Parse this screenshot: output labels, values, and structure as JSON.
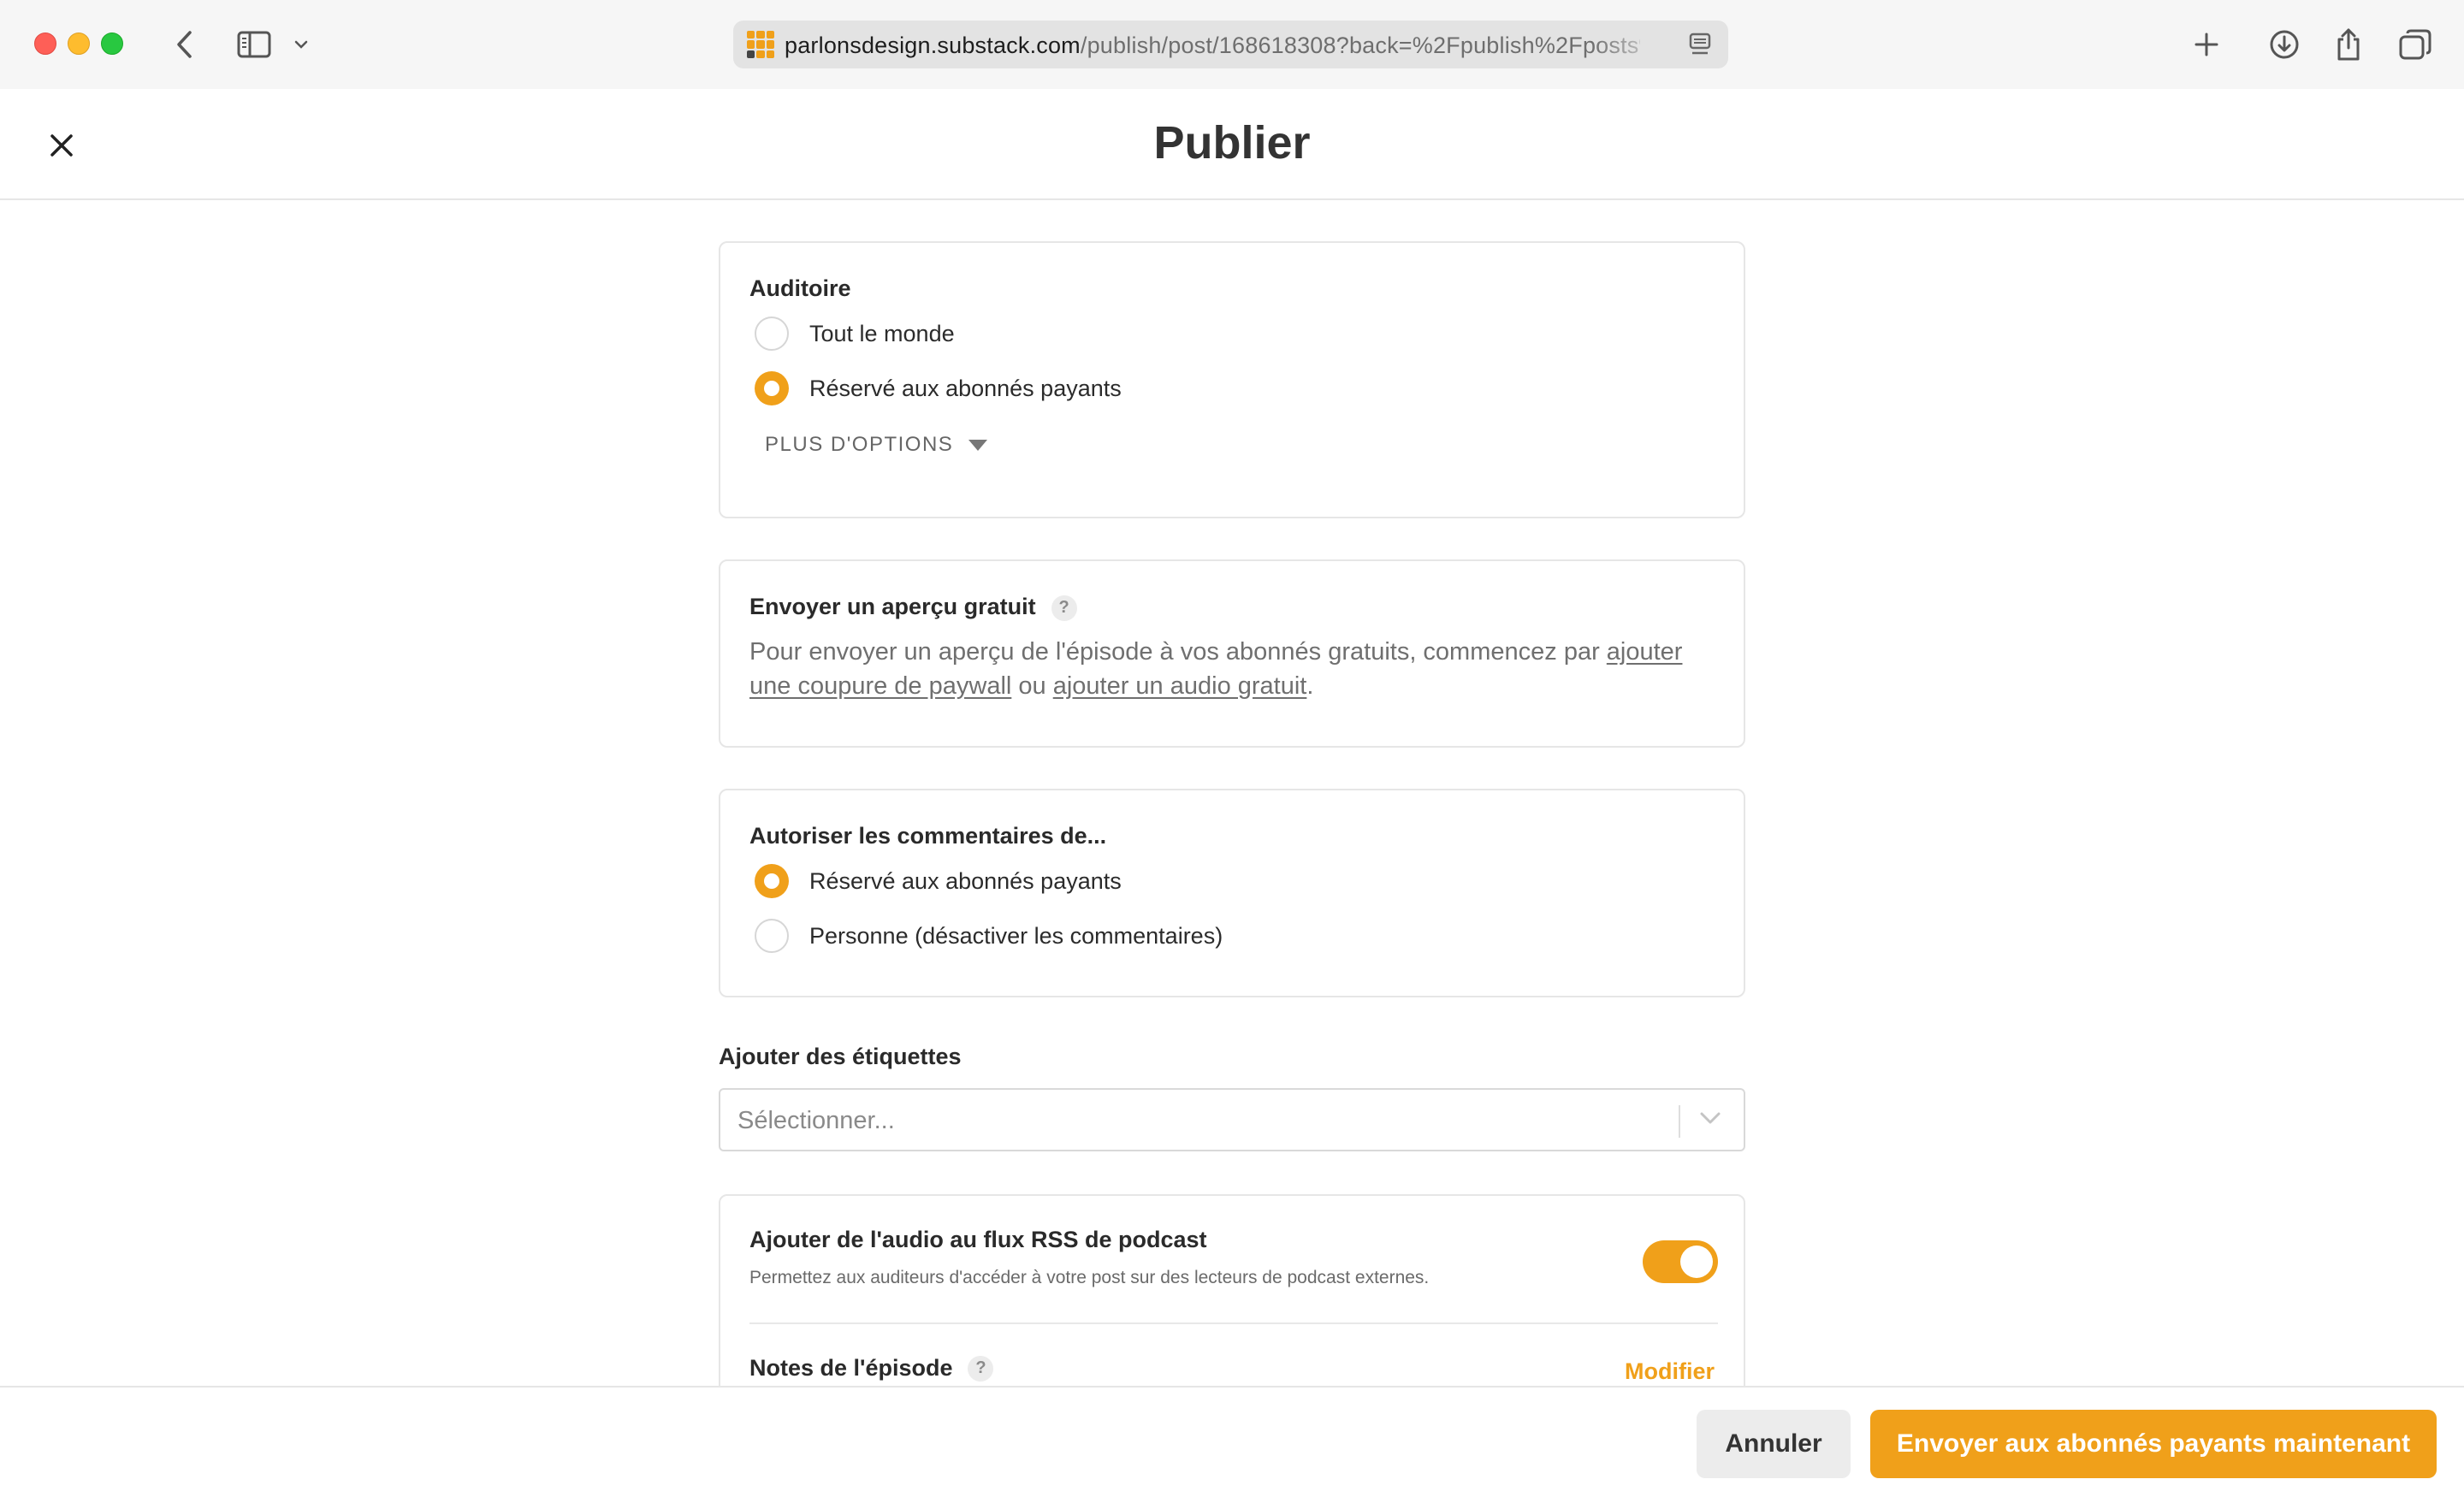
{
  "browser": {
    "url_host": "parlonsdesign.substack.com",
    "url_path": "/publish/post/168618308?back=%2Fpublish%2Fposts%"
  },
  "header": {
    "title": "Publier"
  },
  "audience": {
    "title": "Auditoire",
    "options": [
      {
        "label": "Tout le monde",
        "checked": false
      },
      {
        "label": "Réservé aux abonnés payants",
        "checked": true
      }
    ],
    "more_options": "PLUS D'OPTIONS"
  },
  "free_preview": {
    "title": "Envoyer un aperçu gratuit",
    "help": "?",
    "text_before": "Pour envoyer un aperçu de l'épisode à vos abonnés gratuits, commencez par ",
    "link1": "ajouter une coupure de paywall",
    "text_middle": " ou ",
    "link2": "ajouter un audio gratuit",
    "text_after": "."
  },
  "comments": {
    "title": "Autoriser les commentaires de...",
    "options": [
      {
        "label": "Réservé aux abonnés payants",
        "checked": true
      },
      {
        "label": "Personne (désactiver les commentaires)",
        "checked": false
      }
    ]
  },
  "tags": {
    "label": "Ajouter des étiquettes",
    "placeholder": "Sélectionner..."
  },
  "podcast": {
    "title": "Ajouter de l'audio au flux RSS de podcast",
    "description": "Permettez aux auditeurs d'accéder à votre post sur des lecteurs de podcast externes.",
    "enabled": true,
    "notes_title": "Notes de l'épisode",
    "notes_help": "?",
    "modify_label": "Modifier"
  },
  "footer": {
    "cancel_label": "Annuler",
    "send_label": "Envoyer aux abonnés payants maintenant"
  },
  "colors": {
    "accent": "#f0a01a",
    "traffic_red": "#fe5f57",
    "traffic_yellow": "#febc2e",
    "traffic_green": "#28c840"
  }
}
